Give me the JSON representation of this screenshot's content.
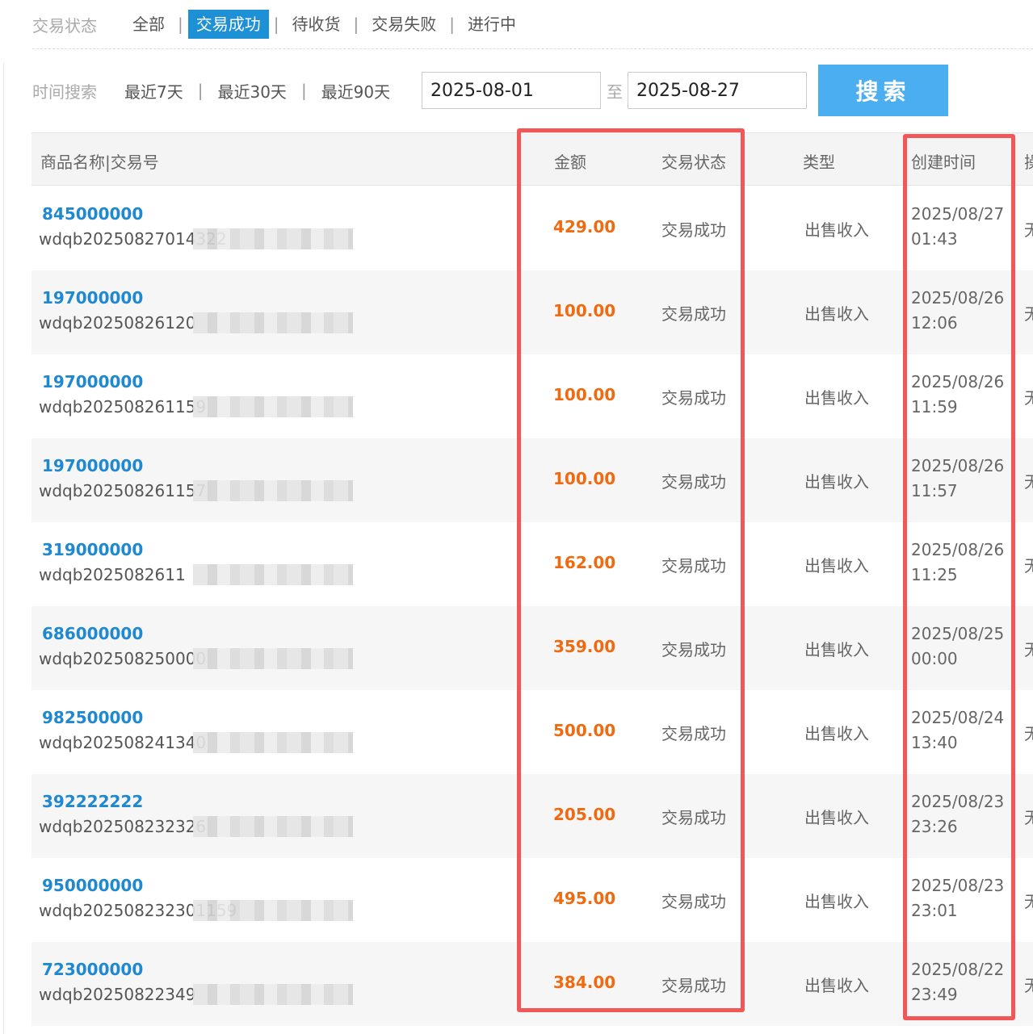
{
  "status_filter": {
    "label": "交易状态",
    "options": [
      "全部",
      "交易成功",
      "待收货",
      "交易失败",
      "进行中"
    ],
    "active_index": 1
  },
  "time_filter": {
    "label": "时间搜索",
    "options": [
      "最近7天",
      "最近30天",
      "最近90天"
    ],
    "from": "2025-08-01",
    "to_label": "至",
    "to": "2025-08-27",
    "search_label": "搜索"
  },
  "table": {
    "headers": {
      "name": "商品名称|交易号",
      "amount": "金额",
      "status": "交易状态",
      "type": "类型",
      "created": "创建时间",
      "more": "操"
    },
    "rows": [
      {
        "pid": "845000000",
        "tno": "wdqb20250827014322",
        "amount": "429.00",
        "status": "交易成功",
        "type": "出售收入",
        "date": "2025/08/27",
        "time": "01:43",
        "more": "无"
      },
      {
        "pid": "197000000",
        "tno": "wdqb20250826120",
        "amount": "100.00",
        "status": "交易成功",
        "type": "出售收入",
        "date": "2025/08/26",
        "time": "12:06",
        "more": "无"
      },
      {
        "pid": "197000000",
        "tno": "wdqb202508261159",
        "amount": "100.00",
        "status": "交易成功",
        "type": "出售收入",
        "date": "2025/08/26",
        "time": "11:59",
        "more": "无"
      },
      {
        "pid": "197000000",
        "tno": "wdqb202508261157",
        "amount": "100.00",
        "status": "交易成功",
        "type": "出售收入",
        "date": "2025/08/26",
        "time": "11:57",
        "more": "无"
      },
      {
        "pid": "319000000",
        "tno": "wdqb2025082611",
        "amount": "162.00",
        "status": "交易成功",
        "type": "出售收入",
        "date": "2025/08/26",
        "time": "11:25",
        "more": "无"
      },
      {
        "pid": "686000000",
        "tno": "wdqb202508250000",
        "amount": "359.00",
        "status": "交易成功",
        "type": "出售收入",
        "date": "2025/08/25",
        "time": "00:00",
        "more": "无"
      },
      {
        "pid": "982500000",
        "tno": "wdqb202508241340",
        "amount": "500.00",
        "status": "交易成功",
        "type": "出售收入",
        "date": "2025/08/24",
        "time": "13:40",
        "more": "无"
      },
      {
        "pid": "392222222",
        "tno": "wdqb202508232326",
        "amount": "205.00",
        "status": "交易成功",
        "type": "出售收入",
        "date": "2025/08/23",
        "time": "23:26",
        "more": "无"
      },
      {
        "pid": "950000000",
        "tno": "wdqb202508232301159",
        "amount": "495.00",
        "status": "交易成功",
        "type": "出售收入",
        "date": "2025/08/23",
        "time": "23:01",
        "more": "无"
      },
      {
        "pid": "723000000",
        "tno": "wdqb20250822349",
        "amount": "384.00",
        "status": "交易成功",
        "type": "出售收入",
        "date": "2025/08/22",
        "time": "23:49",
        "more": "无"
      }
    ]
  },
  "colors": {
    "active_tab": "#1d90d6",
    "search_button": "#4aaef0",
    "product_id": "#1e88d0",
    "amount": "#f06a10",
    "highlight_box": "#f25757"
  }
}
